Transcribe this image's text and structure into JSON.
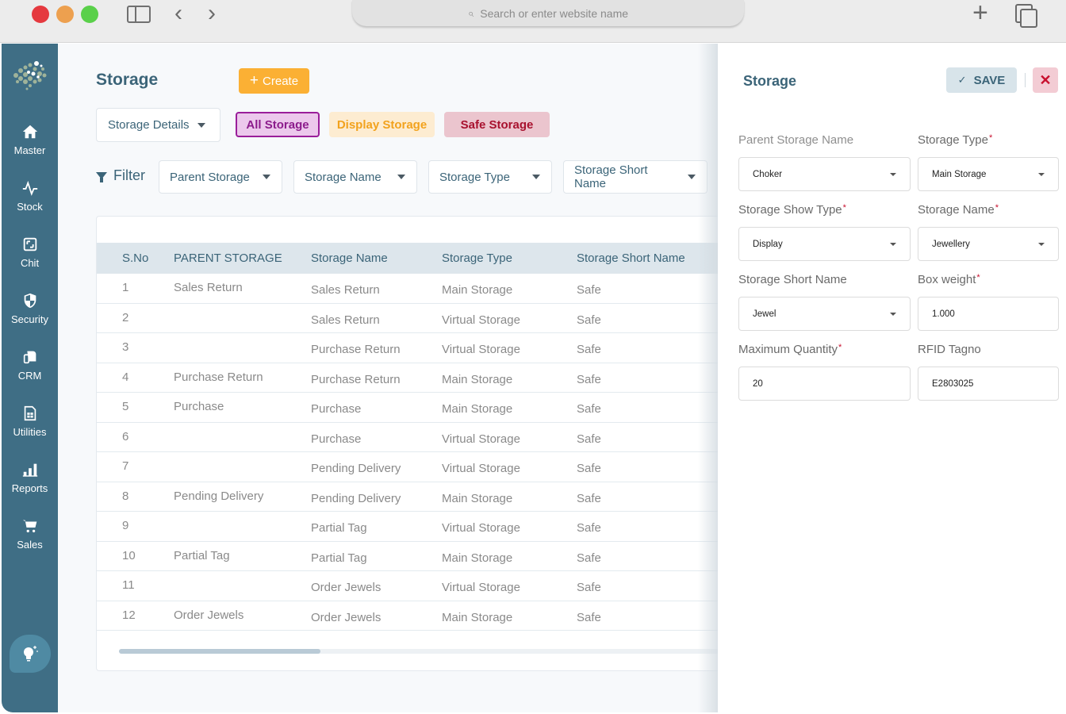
{
  "browser": {
    "url_placeholder": "Search or enter website name"
  },
  "sidebar": {
    "items": [
      {
        "label": "Master",
        "icon": "home-icon"
      },
      {
        "label": "Stock",
        "icon": "activity-icon"
      },
      {
        "label": "Chit",
        "icon": "expand-icon"
      },
      {
        "label": "Security",
        "icon": "shield-icon"
      },
      {
        "label": "CRM",
        "icon": "crm-icon"
      },
      {
        "label": "Utilities",
        "icon": "spreadsheet-icon"
      },
      {
        "label": "Reports",
        "icon": "bar-chart-icon"
      },
      {
        "label": "Sales",
        "icon": "cart-icon"
      }
    ]
  },
  "main": {
    "title": "Storage",
    "create_label": "Create",
    "details_dropdown": "Storage Details",
    "tabs": [
      {
        "label": "All Storage",
        "active": true
      },
      {
        "label": "Display Storage",
        "active": false
      },
      {
        "label": "Safe Storage",
        "active": false
      }
    ],
    "filter_label": "Filter",
    "filters": [
      "Parent Storage",
      "Storage Name",
      "Storage Type",
      "Storage Short Name"
    ],
    "table": {
      "columns": [
        "S.No",
        "PARENT STORAGE",
        "Storage Name",
        "Storage Type",
        "Storage Short Name"
      ],
      "rows": [
        {
          "sno": "1",
          "parent": "Sales Return",
          "name": "Sales Return",
          "type": "Main Storage",
          "short": "Safe"
        },
        {
          "sno": "2",
          "parent": "",
          "name": "Sales Return",
          "type": "Virtual Storage",
          "short": "Safe"
        },
        {
          "sno": "3",
          "parent": "",
          "name": "Purchase Return",
          "type": "Virtual Storage",
          "short": "Safe"
        },
        {
          "sno": "4",
          "parent": "Purchase Return",
          "name": "Purchase Return",
          "type": "Main Storage",
          "short": "Safe"
        },
        {
          "sno": "5",
          "parent": "Purchase",
          "name": "Purchase",
          "type": "Main Storage",
          "short": "Safe"
        },
        {
          "sno": "6",
          "parent": "",
          "name": "Purchase",
          "type": "Virtual Storage",
          "short": "Safe"
        },
        {
          "sno": "7",
          "parent": "",
          "name": "Pending Delivery",
          "type": "Virtual Storage",
          "short": "Safe"
        },
        {
          "sno": "8",
          "parent": "Pending Delivery",
          "name": "Pending Delivery",
          "type": "Main Storage",
          "short": "Safe"
        },
        {
          "sno": "9",
          "parent": "",
          "name": "Partial Tag",
          "type": "Virtual Storage",
          "short": "Safe"
        },
        {
          "sno": "10",
          "parent": "Partial Tag",
          "name": "Partial Tag",
          "type": "Main Storage",
          "short": "Safe"
        },
        {
          "sno": "11",
          "parent": "",
          "name": "Order Jewels",
          "type": "Virtual Storage",
          "short": "Safe"
        },
        {
          "sno": "12",
          "parent": "Order Jewels",
          "name": "Order Jewels",
          "type": "Main Storage",
          "short": "Safe"
        }
      ]
    }
  },
  "panel": {
    "title": "Storage",
    "save_label": "SAVE",
    "close_label": "✕",
    "fields": {
      "parent_storage_name": {
        "label": "Parent Storage Name",
        "value": "Choker",
        "required": false
      },
      "storage_type": {
        "label": "Storage Type",
        "value": "Main Storage",
        "required": true
      },
      "storage_show_type": {
        "label": "Storage Show Type",
        "value": "Display",
        "required": true
      },
      "storage_name": {
        "label": "Storage Name",
        "value": "Jewellery",
        "required": true
      },
      "storage_short_name": {
        "label": "Storage Short Name",
        "value": "Jewel",
        "required": false
      },
      "box_weight": {
        "label": "Box weight",
        "value": "1.000",
        "required": true
      },
      "maximum_quantity": {
        "label": "Maximum Quantity",
        "value": "20",
        "required": true
      },
      "rfid_tagno": {
        "label": "RFID Tagno",
        "value": "E2803025",
        "required": false
      }
    },
    "required_mark": "*"
  },
  "colors": {
    "sidebar_bg": "#3f6e85",
    "primary_text": "#3b6478",
    "create_button": "#fbb034",
    "all_storage_accent": "#9a1e9a",
    "display_storage_accent": "#f2a21d",
    "safe_storage_accent": "#a8112e",
    "close_accent": "#c8102e"
  }
}
